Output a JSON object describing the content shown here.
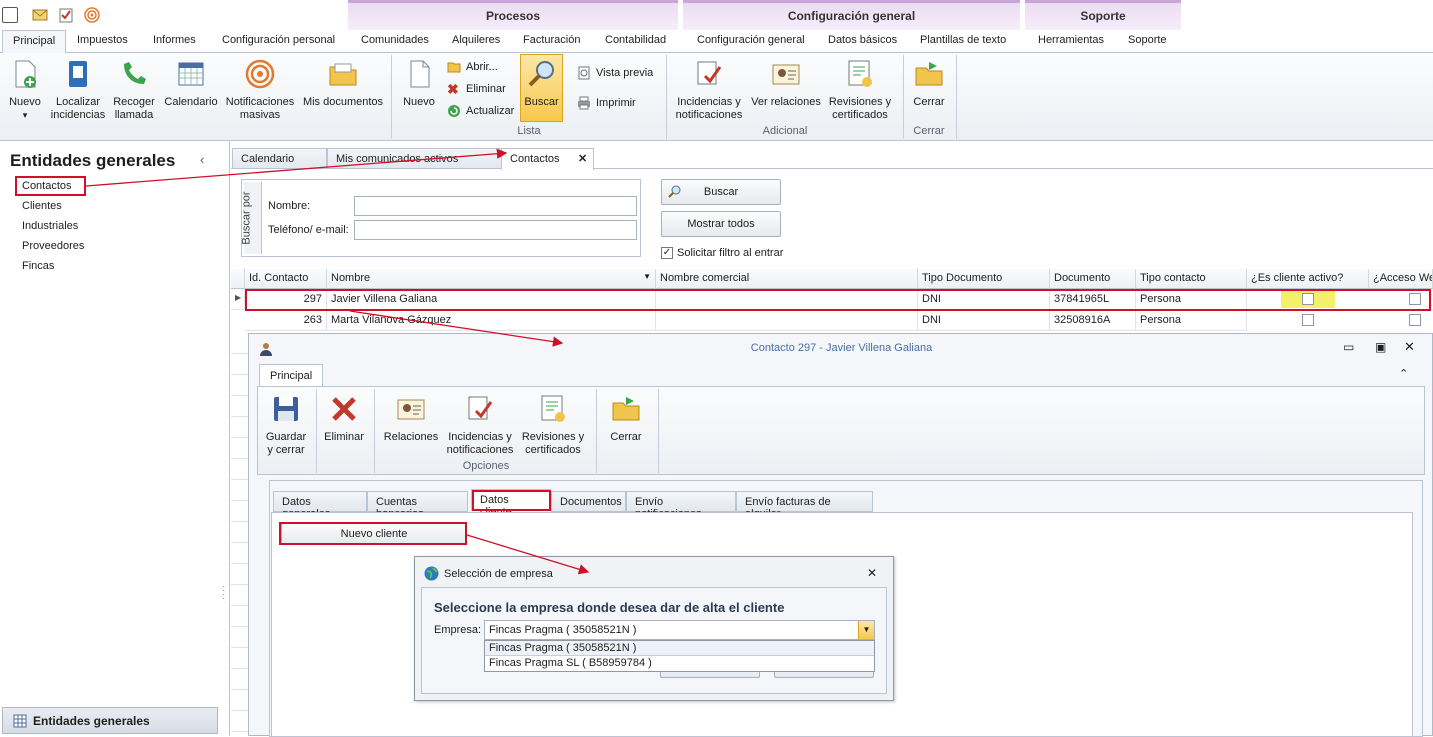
{
  "ribbon_context_groups": {
    "procesos": "Procesos",
    "config": "Configuración general",
    "soporte": "Soporte"
  },
  "ribbon_tabs": [
    "Principal",
    "Impuestos",
    "Informes",
    "Configuración personal",
    "Comunidades",
    "Alquileres",
    "Facturación",
    "Contabilidad",
    "Configuración general",
    "Datos básicos",
    "Plantillas de texto",
    "Herramientas",
    "Soporte"
  ],
  "ribbon_buttons": {
    "nuevo": "Nuevo",
    "localizar": "Localizar incidencias",
    "recoger": "Recoger llamada",
    "calendario": "Calendario",
    "notificaciones": "Notificaciones masivas",
    "mis_documentos": "Mis documentos",
    "nuevo2": "Nuevo",
    "abrir": "Abrir...",
    "eliminar": "Eliminar",
    "actualizar": "Actualizar",
    "buscar": "Buscar",
    "vista_previa": "Vista previa",
    "imprimir": "Imprimir",
    "incidencias": "Incidencias y notificaciones",
    "ver_relaciones": "Ver relaciones",
    "revisiones": "Revisiones y certificados",
    "cerrar": "Cerrar"
  },
  "ribbon_groups": {
    "lista": "Lista",
    "adicional": "Adicional",
    "cerrar": "Cerrar"
  },
  "left_panel": {
    "title": "Entidades generales",
    "items": [
      "Contactos",
      "Clientes",
      "Industriales",
      "Proveedores",
      "Fincas"
    ],
    "bottom": "Entidades generales"
  },
  "doc_tabs": [
    "Calendario",
    "Mis comunicados activos",
    "Contactos"
  ],
  "search": {
    "group_label": "Buscar por",
    "nombre_label": "Nombre:",
    "telefono_label": "Teléfono/ e-mail:",
    "buscar_btn": "Buscar",
    "mostrar_btn": "Mostrar todos",
    "filtro_label": "Solicitar filtro al entrar"
  },
  "grid": {
    "columns": [
      "Id. Contacto",
      "Nombre",
      "Nombre comercial",
      "Tipo Documento",
      "Documento",
      "Tipo contacto",
      "¿Es cliente activo?",
      "¿Acceso Web"
    ],
    "rows": [
      {
        "id": "297",
        "nombre": "Javier Villena Galiana",
        "comercial": "",
        "tipo_doc": "DNI",
        "documento": "37841965L",
        "tipo_contacto": "Persona"
      },
      {
        "id": "263",
        "nombre": "Marta Vilanova Gázquez",
        "comercial": "",
        "tipo_doc": "DNI",
        "documento": "32508916A",
        "tipo_contacto": "Persona"
      }
    ]
  },
  "dialog": {
    "title": "Contacto 297 - Javier Villena Galiana",
    "tab": "Principal",
    "buttons": {
      "guardar": "Guardar y cerrar",
      "eliminar": "Eliminar",
      "relaciones": "Relaciones",
      "incidencias": "Incidencias y notificaciones",
      "revisiones": "Revisiones y certificados",
      "cerrar": "Cerrar"
    },
    "group": "Opciones",
    "tabs": [
      "Datos generales",
      "Cuentas bancarias",
      "Datos cliente",
      "Documentos",
      "Envío notificaciones",
      "Envío facturas de alquiler"
    ],
    "nuevo_cliente": "Nuevo cliente"
  },
  "popup": {
    "title": "Selección de empresa",
    "heading": "Seleccione la empresa donde desea dar de alta el cliente",
    "empresa_label": "Empresa:",
    "selected": "Fincas Pragma ( 35058521N )",
    "options": [
      "Fincas Pragma ( 35058521N )",
      "Fincas Pragma SL ( B58959784 )"
    ]
  },
  "colors": {
    "highlight": "#d0102b",
    "accent": "#f5d36b"
  }
}
